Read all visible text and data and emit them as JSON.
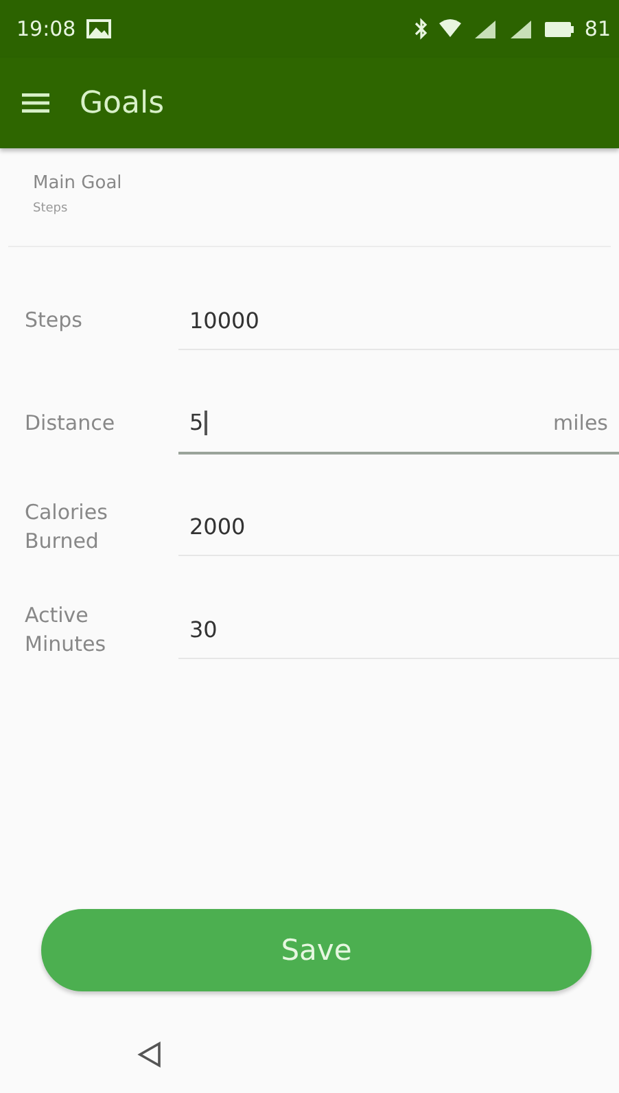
{
  "status_bar": {
    "time": "19:08",
    "battery": "81"
  },
  "toolbar": {
    "title": "Goals"
  },
  "main_goal": {
    "label": "Main Goal",
    "value": "Steps"
  },
  "fields": [
    {
      "label": "Steps",
      "value": "10000",
      "focused": false
    },
    {
      "label": "Distance",
      "value": "5",
      "suffix": "miles",
      "focused": true
    },
    {
      "label": "Calories Burned",
      "value": "2000",
      "focused": false
    },
    {
      "label": "Active Minutes",
      "value": "30",
      "focused": false
    }
  ],
  "save_button": "Save"
}
